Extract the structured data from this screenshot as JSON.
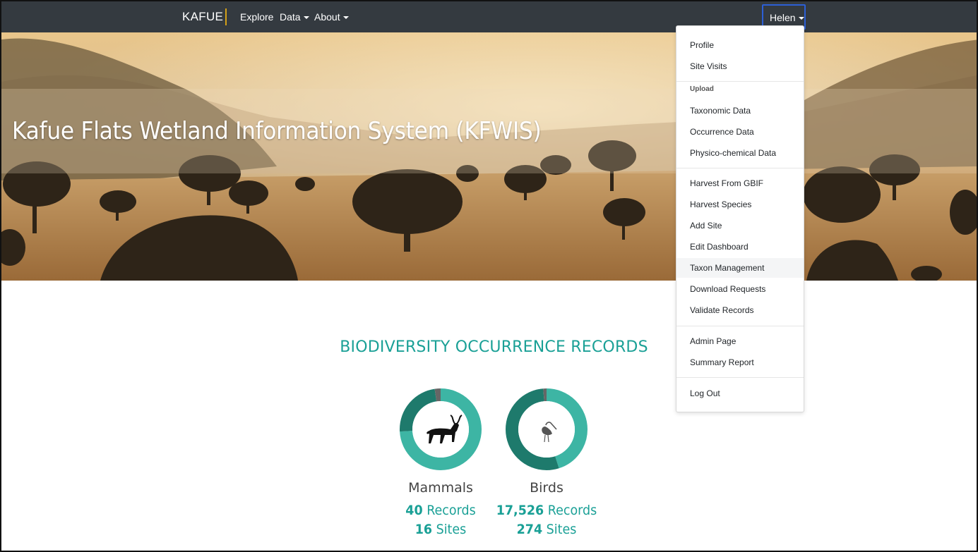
{
  "navbar": {
    "brand": "KAFUE",
    "items": [
      {
        "label": "Explore",
        "caret": false
      },
      {
        "label": "Data",
        "caret": true
      },
      {
        "label": "About",
        "caret": true
      }
    ],
    "user": "Helen"
  },
  "hero": {
    "title": "Kafue Flats Wetland Information System (KFWIS)"
  },
  "section": {
    "title": "BIODIVERSITY OCCURRENCE RECORDS"
  },
  "stats": [
    {
      "name": "Mammals",
      "records_count": "40",
      "records_label": "Records",
      "sites_count": "16",
      "sites_label": "Sites",
      "icon": "kudu-icon",
      "donut_fractions": [
        0.74,
        0.235,
        0.025
      ]
    },
    {
      "name": "Birds",
      "records_count": "17,526",
      "records_label": "Records",
      "sites_count": "274",
      "sites_label": "Sites",
      "icon": "stork-icon",
      "donut_fractions": [
        0.45,
        0.535,
        0.015
      ]
    }
  ],
  "colors": {
    "navbar": "#343a40",
    "accent": "#1aa096",
    "donut_light": "#3db5a4",
    "donut_dark": "#1e7a6c",
    "donut_grey": "#666666",
    "active_border": "#2c5fd6"
  },
  "dropdown": {
    "items": {
      "profile": "Profile",
      "site_visits": "Site Visits",
      "upload_header": "Upload",
      "taxonomic_data": "Taxonomic Data",
      "occurrence_data": "Occurrence Data",
      "physico_chemical_data": "Physico-chemical Data",
      "harvest_gbif": "Harvest From GBIF",
      "harvest_species": "Harvest Species",
      "add_site": "Add Site",
      "edit_dashboard": "Edit Dashboard",
      "taxon_management": "Taxon Management",
      "download_requests": "Download Requests",
      "validate_records": "Validate Records",
      "admin_page": "Admin Page",
      "summary_report": "Summary Report",
      "log_out": "Log Out"
    },
    "active": "taxon_management"
  }
}
